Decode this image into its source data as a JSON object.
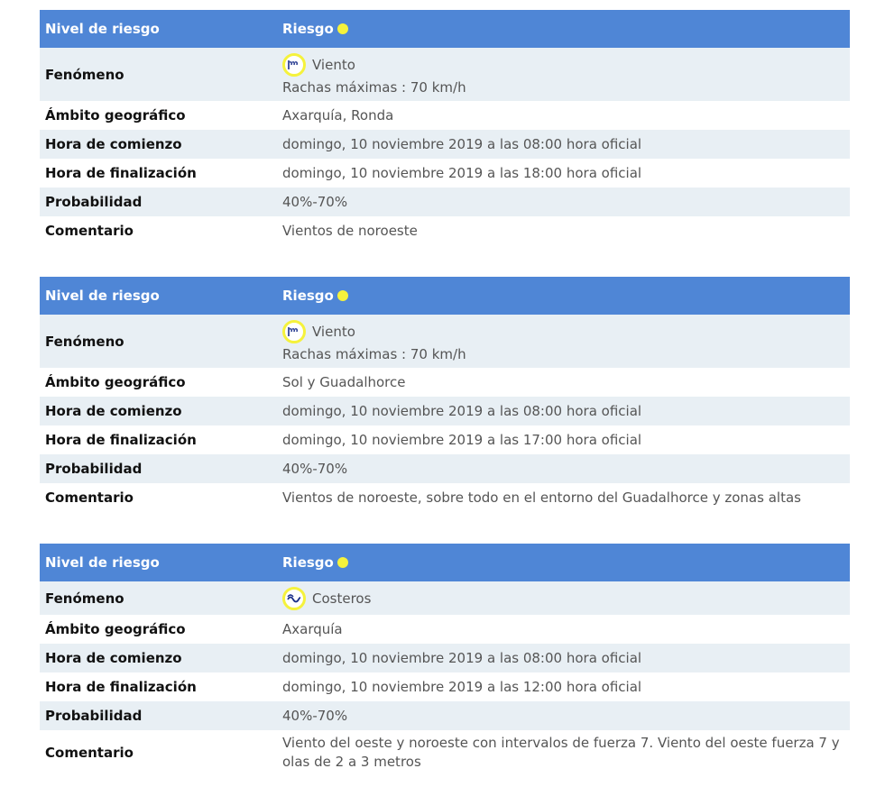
{
  "tables": [
    {
      "header": {
        "label": "Nivel de riesgo",
        "value": "Riesgo",
        "dot_color": "#f5f23c"
      },
      "phenomenon": {
        "label": "Fenómeno",
        "icon": "wind-icon",
        "name": "Viento",
        "detail": "Rachas máximas : 70 km/h"
      },
      "area": {
        "label": "Ámbito geográfico",
        "value": "Axarquía, Ronda"
      },
      "start": {
        "label": "Hora de comienzo",
        "value": "domingo, 10 noviembre 2019 a las 08:00 hora oficial"
      },
      "end": {
        "label": "Hora de finalización",
        "value": "domingo, 10 noviembre 2019 a las 18:00 hora oficial"
      },
      "probability": {
        "label": "Probabilidad",
        "value": "40%-70%"
      },
      "comment": {
        "label": "Comentario",
        "value": "Vientos de noroeste"
      }
    },
    {
      "header": {
        "label": "Nivel de riesgo",
        "value": "Riesgo",
        "dot_color": "#f5f23c"
      },
      "phenomenon": {
        "label": "Fenómeno",
        "icon": "wind-icon",
        "name": "Viento",
        "detail": "Rachas máximas : 70 km/h"
      },
      "area": {
        "label": "Ámbito geográfico",
        "value": "Sol y Guadalhorce"
      },
      "start": {
        "label": "Hora de comienzo",
        "value": "domingo, 10 noviembre 2019 a las 08:00 hora oficial"
      },
      "end": {
        "label": "Hora de finalización",
        "value": "domingo, 10 noviembre 2019 a las 17:00 hora oficial"
      },
      "probability": {
        "label": "Probabilidad",
        "value": "40%-70%"
      },
      "comment": {
        "label": "Comentario",
        "value": "Vientos de noroeste, sobre todo en el entorno del Guadalhorce y zonas altas"
      }
    },
    {
      "header": {
        "label": "Nivel de riesgo",
        "value": "Riesgo",
        "dot_color": "#f5f23c"
      },
      "phenomenon": {
        "label": "Fenómeno",
        "icon": "coastal-waves-icon",
        "name": "Costeros"
      },
      "area": {
        "label": "Ámbito geográfico",
        "value": "Axarquía"
      },
      "start": {
        "label": "Hora de comienzo",
        "value": "domingo, 10 noviembre 2019 a las 08:00 hora oficial"
      },
      "end": {
        "label": "Hora de finalización",
        "value": "domingo, 10 noviembre 2019 a las 12:00 hora oficial"
      },
      "probability": {
        "label": "Probabilidad",
        "value": "40%-70%"
      },
      "comment": {
        "label": "Comentario",
        "value": "Viento del oeste y noroeste con intervalos de fuerza 7. Viento del oeste fuerza 7 y olas de 2 a 3 metros"
      }
    }
  ]
}
